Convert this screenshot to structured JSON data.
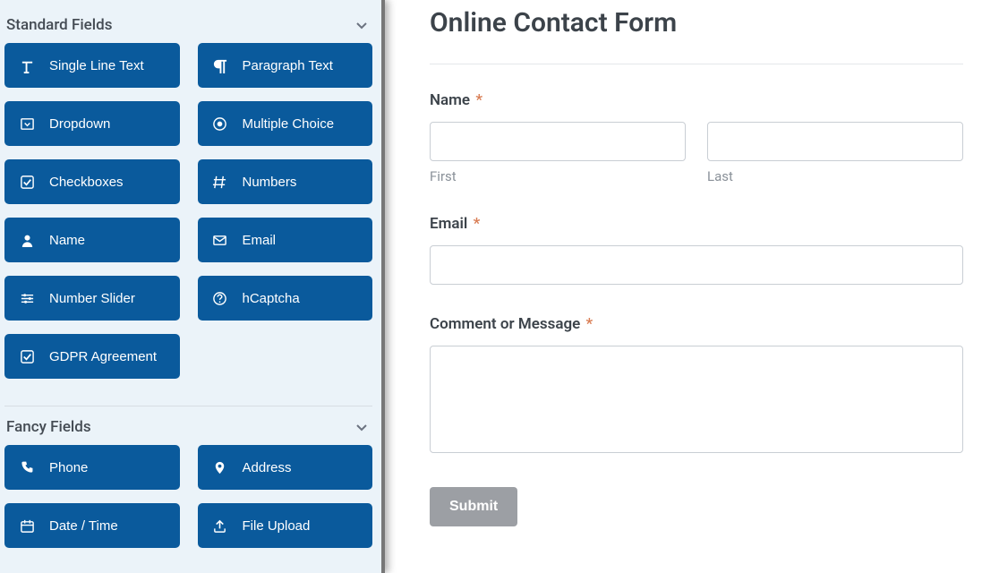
{
  "sidebar": {
    "standard": {
      "title": "Standard Fields",
      "items": [
        {
          "label": "Single Line Text",
          "icon": "text-icon",
          "name": "field-single-line-text"
        },
        {
          "label": "Paragraph Text",
          "icon": "paragraph-icon",
          "name": "field-paragraph-text"
        },
        {
          "label": "Dropdown",
          "icon": "dropdown-icon",
          "name": "field-dropdown"
        },
        {
          "label": "Multiple Choice",
          "icon": "radio-icon",
          "name": "field-multiple-choice"
        },
        {
          "label": "Checkboxes",
          "icon": "checkbox-icon",
          "name": "field-checkboxes"
        },
        {
          "label": "Numbers",
          "icon": "hash-icon",
          "name": "field-numbers"
        },
        {
          "label": "Name",
          "icon": "user-icon",
          "name": "field-name"
        },
        {
          "label": "Email",
          "icon": "envelope-icon",
          "name": "field-email"
        },
        {
          "label": "Number Slider",
          "icon": "sliders-icon",
          "name": "field-number-slider"
        },
        {
          "label": "hCaptcha",
          "icon": "question-icon",
          "name": "field-hcaptcha"
        },
        {
          "label": "GDPR Agreement",
          "icon": "checkbox-icon",
          "name": "field-gdpr-agreement"
        }
      ]
    },
    "fancy": {
      "title": "Fancy Fields",
      "items": [
        {
          "label": "Phone",
          "icon": "phone-icon",
          "name": "field-phone"
        },
        {
          "label": "Address",
          "icon": "marker-icon",
          "name": "field-address"
        },
        {
          "label": "Date / Time",
          "icon": "calendar-icon",
          "name": "field-date-time"
        },
        {
          "label": "File Upload",
          "icon": "upload-icon",
          "name": "field-file-upload"
        }
      ]
    }
  },
  "form": {
    "title": "Online Contact Form",
    "name_label": "Name",
    "first_sub": "First",
    "last_sub": "Last",
    "email_label": "Email",
    "message_label": "Comment or Message",
    "required_mark": "*",
    "submit_label": "Submit"
  }
}
